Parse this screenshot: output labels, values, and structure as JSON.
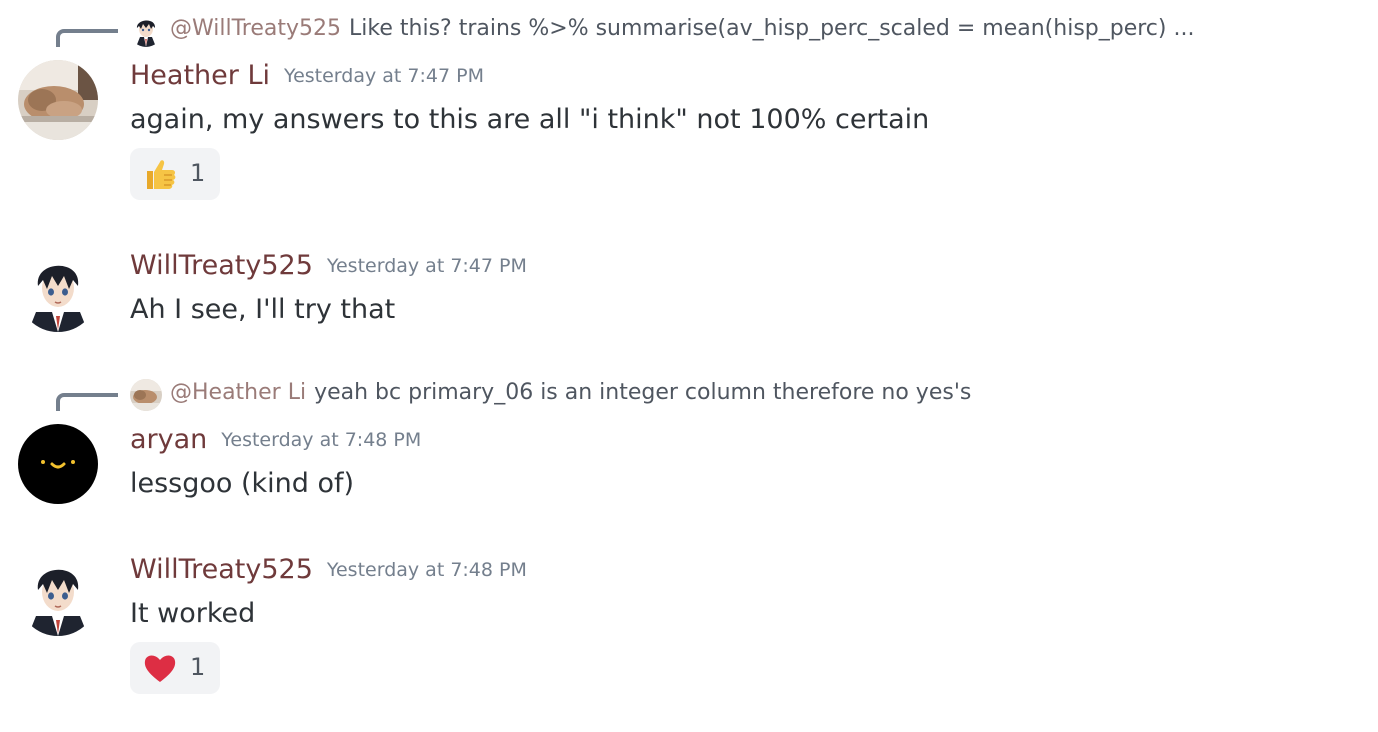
{
  "messages": [
    {
      "reply": {
        "mention": "@WillTreaty525",
        "text": "Like this? trains %>%  summarise(av_hisp_perc_scaled = mean(hisp_perc) ..."
      },
      "author": "Heather Li",
      "timestamp": "Yesterday at 7:47 PM",
      "content": "again, my answers to this are all \"i think\" not 100% certain",
      "reaction": {
        "emoji": "thumbs-up",
        "count": "1"
      }
    },
    {
      "author": "WillTreaty525",
      "timestamp": "Yesterday at 7:47 PM",
      "content": "Ah I see, I'll try that"
    },
    {
      "reply": {
        "mention": "@Heather Li",
        "text": "yeah bc primary_06 is an integer column therefore no yes's"
      },
      "author": "aryan",
      "timestamp": "Yesterday at 7:48 PM",
      "content": "lessgoo (kind of)"
    },
    {
      "author": "WillTreaty525",
      "timestamp": "Yesterday at 7:48 PM",
      "content": "It worked",
      "reaction": {
        "emoji": "heart",
        "count": "1"
      }
    }
  ],
  "colors": {
    "username": "#6f3a3b",
    "mention": "#9a7b78",
    "timestamp": "#747f8d",
    "reaction_bg": "#f2f3f5"
  }
}
